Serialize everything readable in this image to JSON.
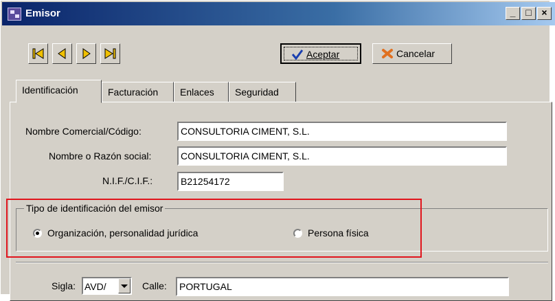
{
  "window": {
    "title": "Emisor",
    "minimize": "_",
    "maximize": "□",
    "close": "×"
  },
  "toolbar": {
    "accept_label": "Aceptar",
    "cancel_label": "Cancelar"
  },
  "tabs": [
    {
      "label": "Identificación",
      "active": true
    },
    {
      "label": "Facturación",
      "active": false
    },
    {
      "label": "Enlaces",
      "active": false
    },
    {
      "label": "Seguridad",
      "active": false
    }
  ],
  "form": {
    "nombre_comercial": {
      "label": "Nombre Comercial/Código:",
      "value": "CONSULTORIA CIMENT, S.L."
    },
    "razon_social": {
      "label": "Nombre o Razón social:",
      "value": "CONSULTORIA CIMENT, S.L."
    },
    "nif": {
      "label": "N.I.F./C.I.F.:",
      "value": "B21254172"
    }
  },
  "tipo": {
    "title": "Tipo de identificación del emisor",
    "option_org": "Organización, personalidad jurídica",
    "option_persona": "Persona física",
    "selected": "organizacion"
  },
  "address": {
    "sigla_label": "Sigla:",
    "sigla_value": "AVD/",
    "calle_label": "Calle:",
    "calle_value": "PORTUGAL"
  },
  "colors": {
    "titlebar": "#0a246a",
    "highlight": "#e0141c",
    "face": "#d4d0c8"
  }
}
